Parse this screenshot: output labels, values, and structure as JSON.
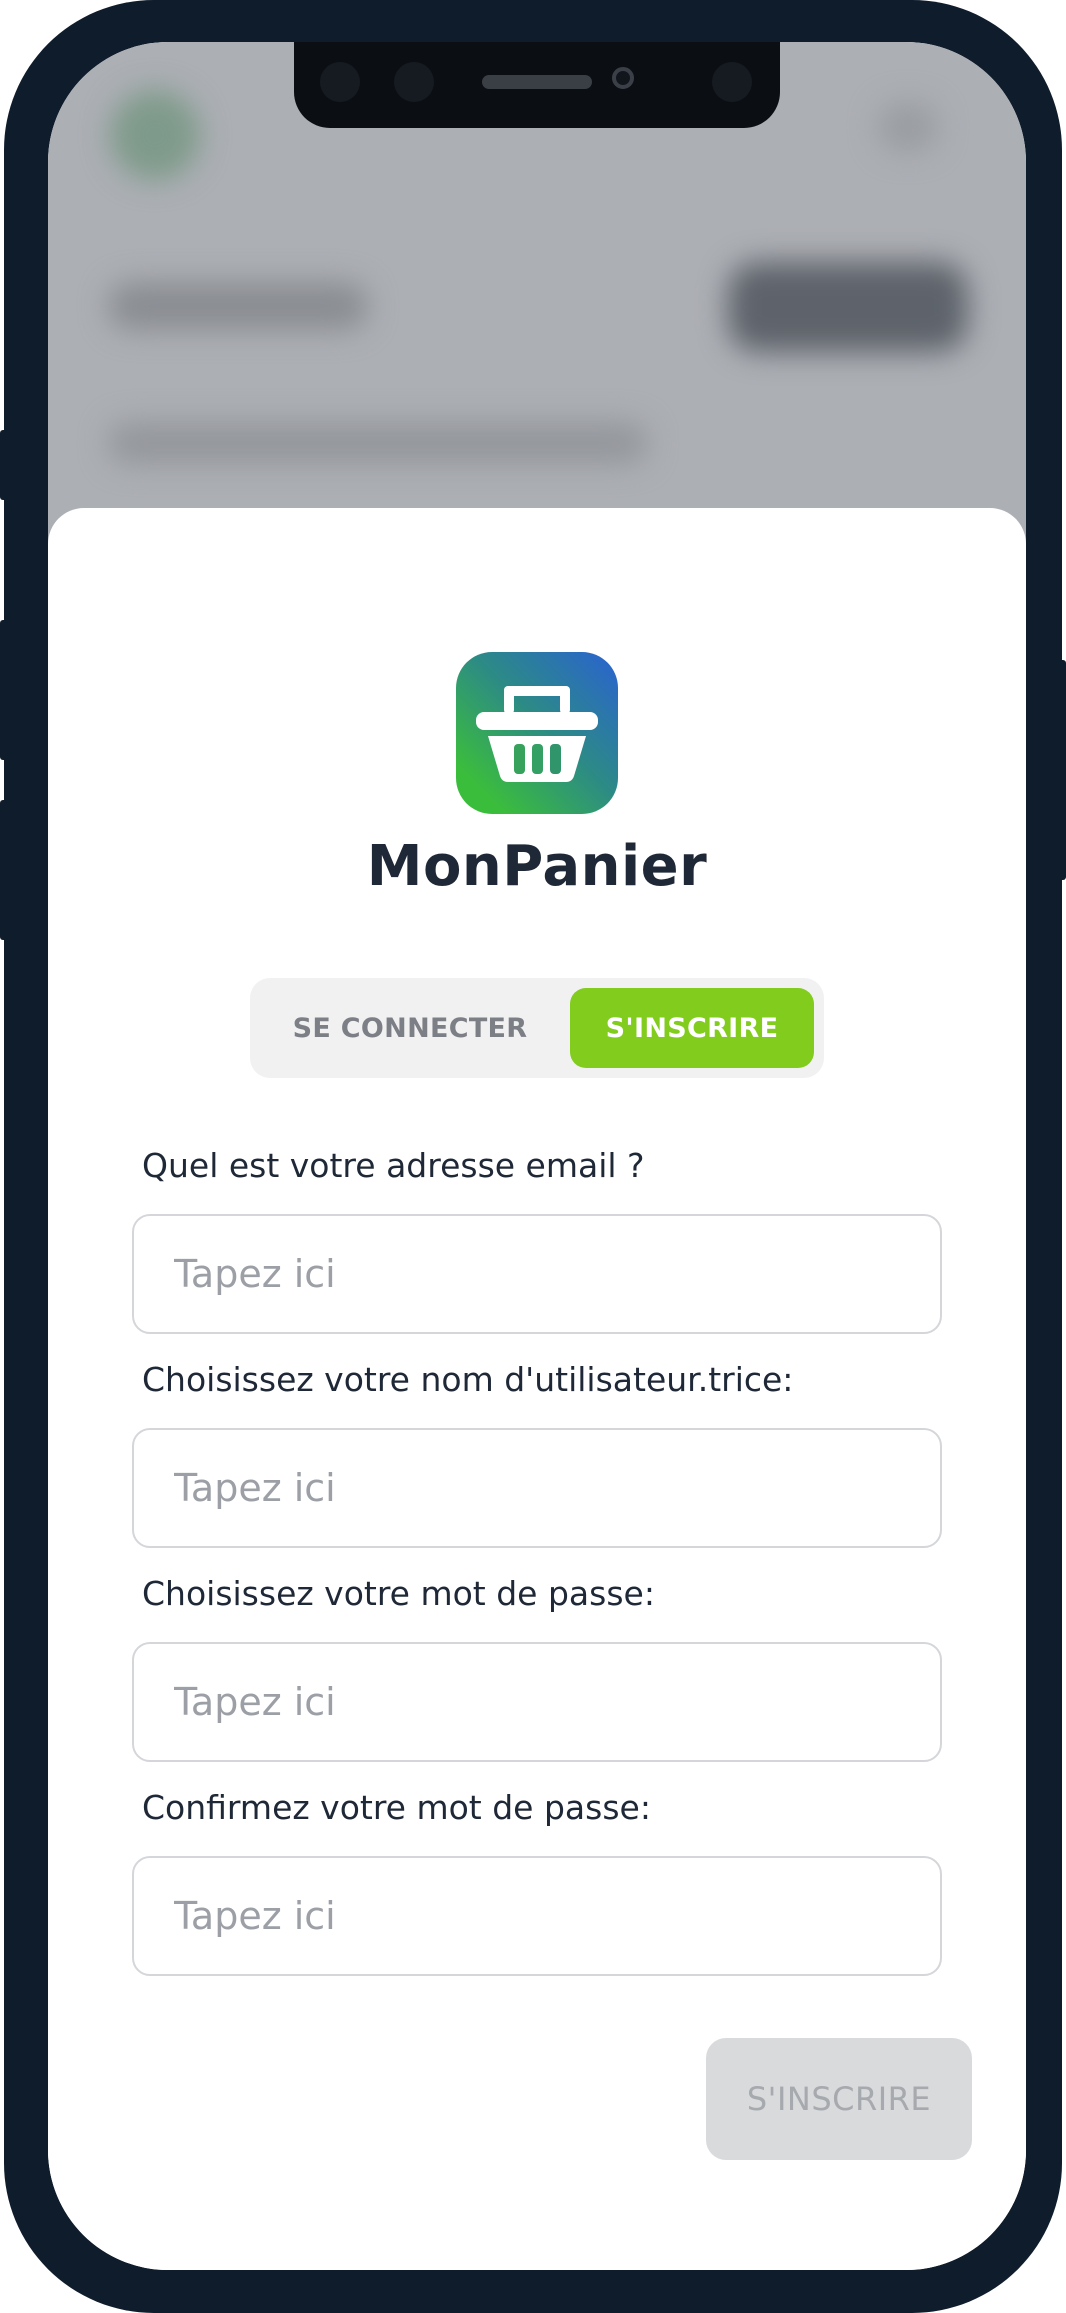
{
  "app": {
    "name": "MonPanier",
    "logo_icon": "shopping-basket-icon"
  },
  "colors": {
    "accent_green": "#82cc1e",
    "logo_gradient_start": "#2a62d2",
    "logo_gradient_end": "#3bbd3c",
    "title_text": "#1f2837",
    "disabled_button": "#d9dadc"
  },
  "auth_tabs": {
    "login_label": "SE CONNECTER",
    "signup_label": "S'INSCRIRE",
    "active": "signup"
  },
  "form": {
    "email": {
      "label": "Quel est votre adresse email ?",
      "placeholder": "Tapez ici",
      "value": ""
    },
    "username": {
      "label": "Choisissez votre nom d'utilisateur.trice:",
      "placeholder": "Tapez ici",
      "value": ""
    },
    "password": {
      "label": "Choisissez votre mot de passe:",
      "placeholder": "Tapez ici",
      "value": ""
    },
    "password_confirm": {
      "label": "Confirmez votre mot de passe:",
      "placeholder": "Tapez ici",
      "value": ""
    },
    "submit_label": "S'INSCRIRE",
    "submit_enabled": false
  }
}
